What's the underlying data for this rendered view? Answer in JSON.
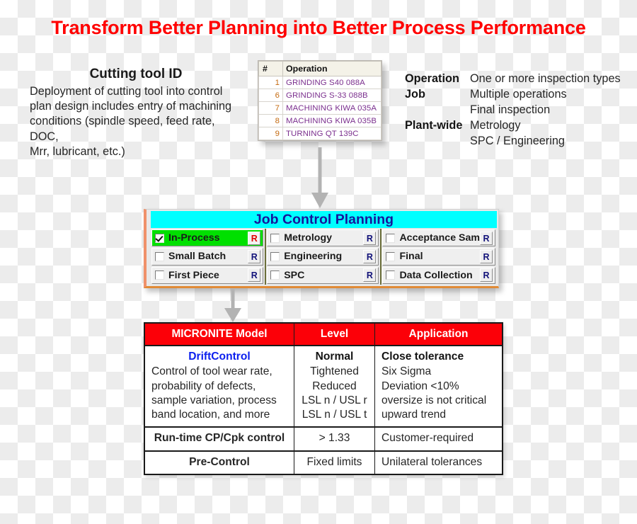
{
  "title": "Transform Better Planning into Better Process Performance",
  "title_color": "#ff0000",
  "cutting_tool": {
    "heading": "Cutting tool ID",
    "lines": [
      "Deployment of cutting tool into control",
      "plan design includes  entry of machining",
      "conditions (spindle speed, feed rate, DOC,",
      "Mrr, lubricant, etc.)"
    ]
  },
  "operations_table": {
    "headers": [
      "#",
      "Operation"
    ],
    "rows": [
      {
        "num": "1",
        "operation": "GRINDING S40 088A"
      },
      {
        "num": "6",
        "operation": "GRINDING  S-33 088B"
      },
      {
        "num": "7",
        "operation": "MACHINING KIWA 035A"
      },
      {
        "num": "8",
        "operation": "MACHINING KIWA 035B"
      },
      {
        "num": "9",
        "operation": "TURNING QT 139C"
      }
    ],
    "num_color": "#c46a10",
    "operation_color": "#7b2f8e"
  },
  "legend": {
    "rows": [
      {
        "term": "Operation",
        "desc": "One or more inspection types"
      },
      {
        "term": "Job",
        "desc": "Multiple operations"
      },
      {
        "term": "",
        "desc": "Final inspection"
      },
      {
        "term": "Plant-wide",
        "desc": "Metrology"
      },
      {
        "term": "",
        "desc": "SPC / Engineering"
      }
    ]
  },
  "job_control_panel": {
    "title": "Job Control Planning",
    "title_bg": "#00ffff",
    "title_color": "#16169c",
    "highlight_color": "#00e000",
    "columns": [
      {
        "items": [
          {
            "label": "In-Process",
            "checked": true,
            "r_label": "R",
            "r_color": "#e00000",
            "highlighted": true
          },
          {
            "label": "Small Batch",
            "checked": false,
            "r_label": "R",
            "r_color": "#13137a",
            "highlighted": false
          },
          {
            "label": "First Piece",
            "checked": false,
            "r_label": "R",
            "r_color": "#13137a",
            "highlighted": false
          }
        ]
      },
      {
        "items": [
          {
            "label": "Metrology",
            "checked": false,
            "r_label": "R",
            "r_color": "#13137a",
            "highlighted": false
          },
          {
            "label": "Engineering",
            "checked": false,
            "r_label": "R",
            "r_color": "#13137a",
            "highlighted": false
          },
          {
            "label": "SPC",
            "checked": false,
            "r_label": "R",
            "r_color": "#13137a",
            "highlighted": false
          }
        ]
      },
      {
        "items": [
          {
            "label": "Acceptance Sam",
            "checked": false,
            "r_label": "R",
            "r_color": "#13137a",
            "highlighted": false
          },
          {
            "label": "Final",
            "checked": false,
            "r_label": "R",
            "r_color": "#13137a",
            "highlighted": false
          },
          {
            "label": "Data Collection",
            "checked": false,
            "r_label": "R",
            "r_color": "#13137a",
            "highlighted": false
          }
        ]
      }
    ]
  },
  "micronite_table": {
    "header_bg": "#fc0008",
    "headers": [
      "MICRONITE Model",
      "Level",
      "Application"
    ],
    "rows": [
      {
        "model_title": "DriftControl",
        "model_lines": [
          "Control of tool wear rate,",
          "probability of defects,",
          "sample variation, process",
          "band location, and more"
        ],
        "level_title": "Normal",
        "level_lines": [
          "Tightened",
          "Reduced",
          "LSL n / USL r",
          "LSL n / USL t"
        ],
        "app_title": "Close tolerance",
        "app_lines": [
          "Six Sigma",
          "Deviation <10%",
          "oversize is not critical",
          "upward trend"
        ]
      },
      {
        "model_title": "Run-time CP/Cpk  control",
        "model_lines": [],
        "level_title": "",
        "level_lines": [
          "> 1.33"
        ],
        "app_title": "",
        "app_lines": [
          "Customer-required"
        ]
      },
      {
        "model_title": "Pre-Control",
        "model_lines": [],
        "level_title": "",
        "level_lines": [
          "Fixed limits"
        ],
        "app_title": "",
        "app_lines": [
          "Unilateral tolerances"
        ]
      }
    ]
  },
  "arrows": {
    "color": "#b3b3b3",
    "count": 2
  }
}
